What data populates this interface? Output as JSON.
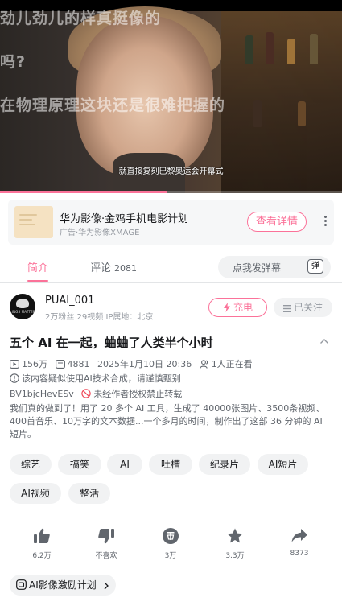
{
  "video": {
    "overlay_lines": [
      "劲儿劲儿的样真挺像的",
      "吗?",
      "在物理原理这块还是很难把握的"
    ],
    "caption": "就直接复刻巴黎奥运会开幕式",
    "progress": 0.49
  },
  "ad": {
    "title": "华为影像·金鸡手机电影计划",
    "subtitle": "广告·华为影像XMAGE",
    "cta": "查看详情"
  },
  "tabs": {
    "intro_label": "简介",
    "comments_label": "评论",
    "comments_count": "2081",
    "danmaku_placeholder": "点我发弹幕",
    "danmaku_icon_text": "弹"
  },
  "uploader": {
    "name": "PUAI_001",
    "stats": "2万粉丝  29视频  IP属地：北京",
    "avatar_text": "LINGS MATTER",
    "charge_label": "充电",
    "follow_label": "已关注"
  },
  "video_info": {
    "title": "五个 AI 在一起，蛐蛐了人类半个小时",
    "views": "156万",
    "danmaku_count": "4881",
    "datetime": "2025年1月10日 20:36",
    "watching": "1人正在看",
    "ai_notice": "该内容疑似使用AI技术合成，请谨慎甄别",
    "bvid": "BV1bjcHevESv",
    "no_repost": "未经作者授权禁止转载",
    "description": "我们真的做到了！用了 20 多个 AI 工具，生成了 40000张图片、3500条视频、400首音乐、10万字的文本数据...一个多月的时间，制作出了这部 36 分钟的 AI 短片。"
  },
  "tags": [
    "综艺",
    "搞笑",
    "AI",
    "吐槽",
    "纪录片",
    "AI短片",
    "AI视频",
    "整活"
  ],
  "actions": {
    "like": "6.2万",
    "dislike": "不喜欢",
    "coin": "3万",
    "favorite": "3.3万",
    "share": "8373"
  },
  "incentive_label": "AI影像激励计划",
  "colors": {
    "accent": "#fb7299",
    "text": "#18191c",
    "secondary": "#61666d"
  }
}
